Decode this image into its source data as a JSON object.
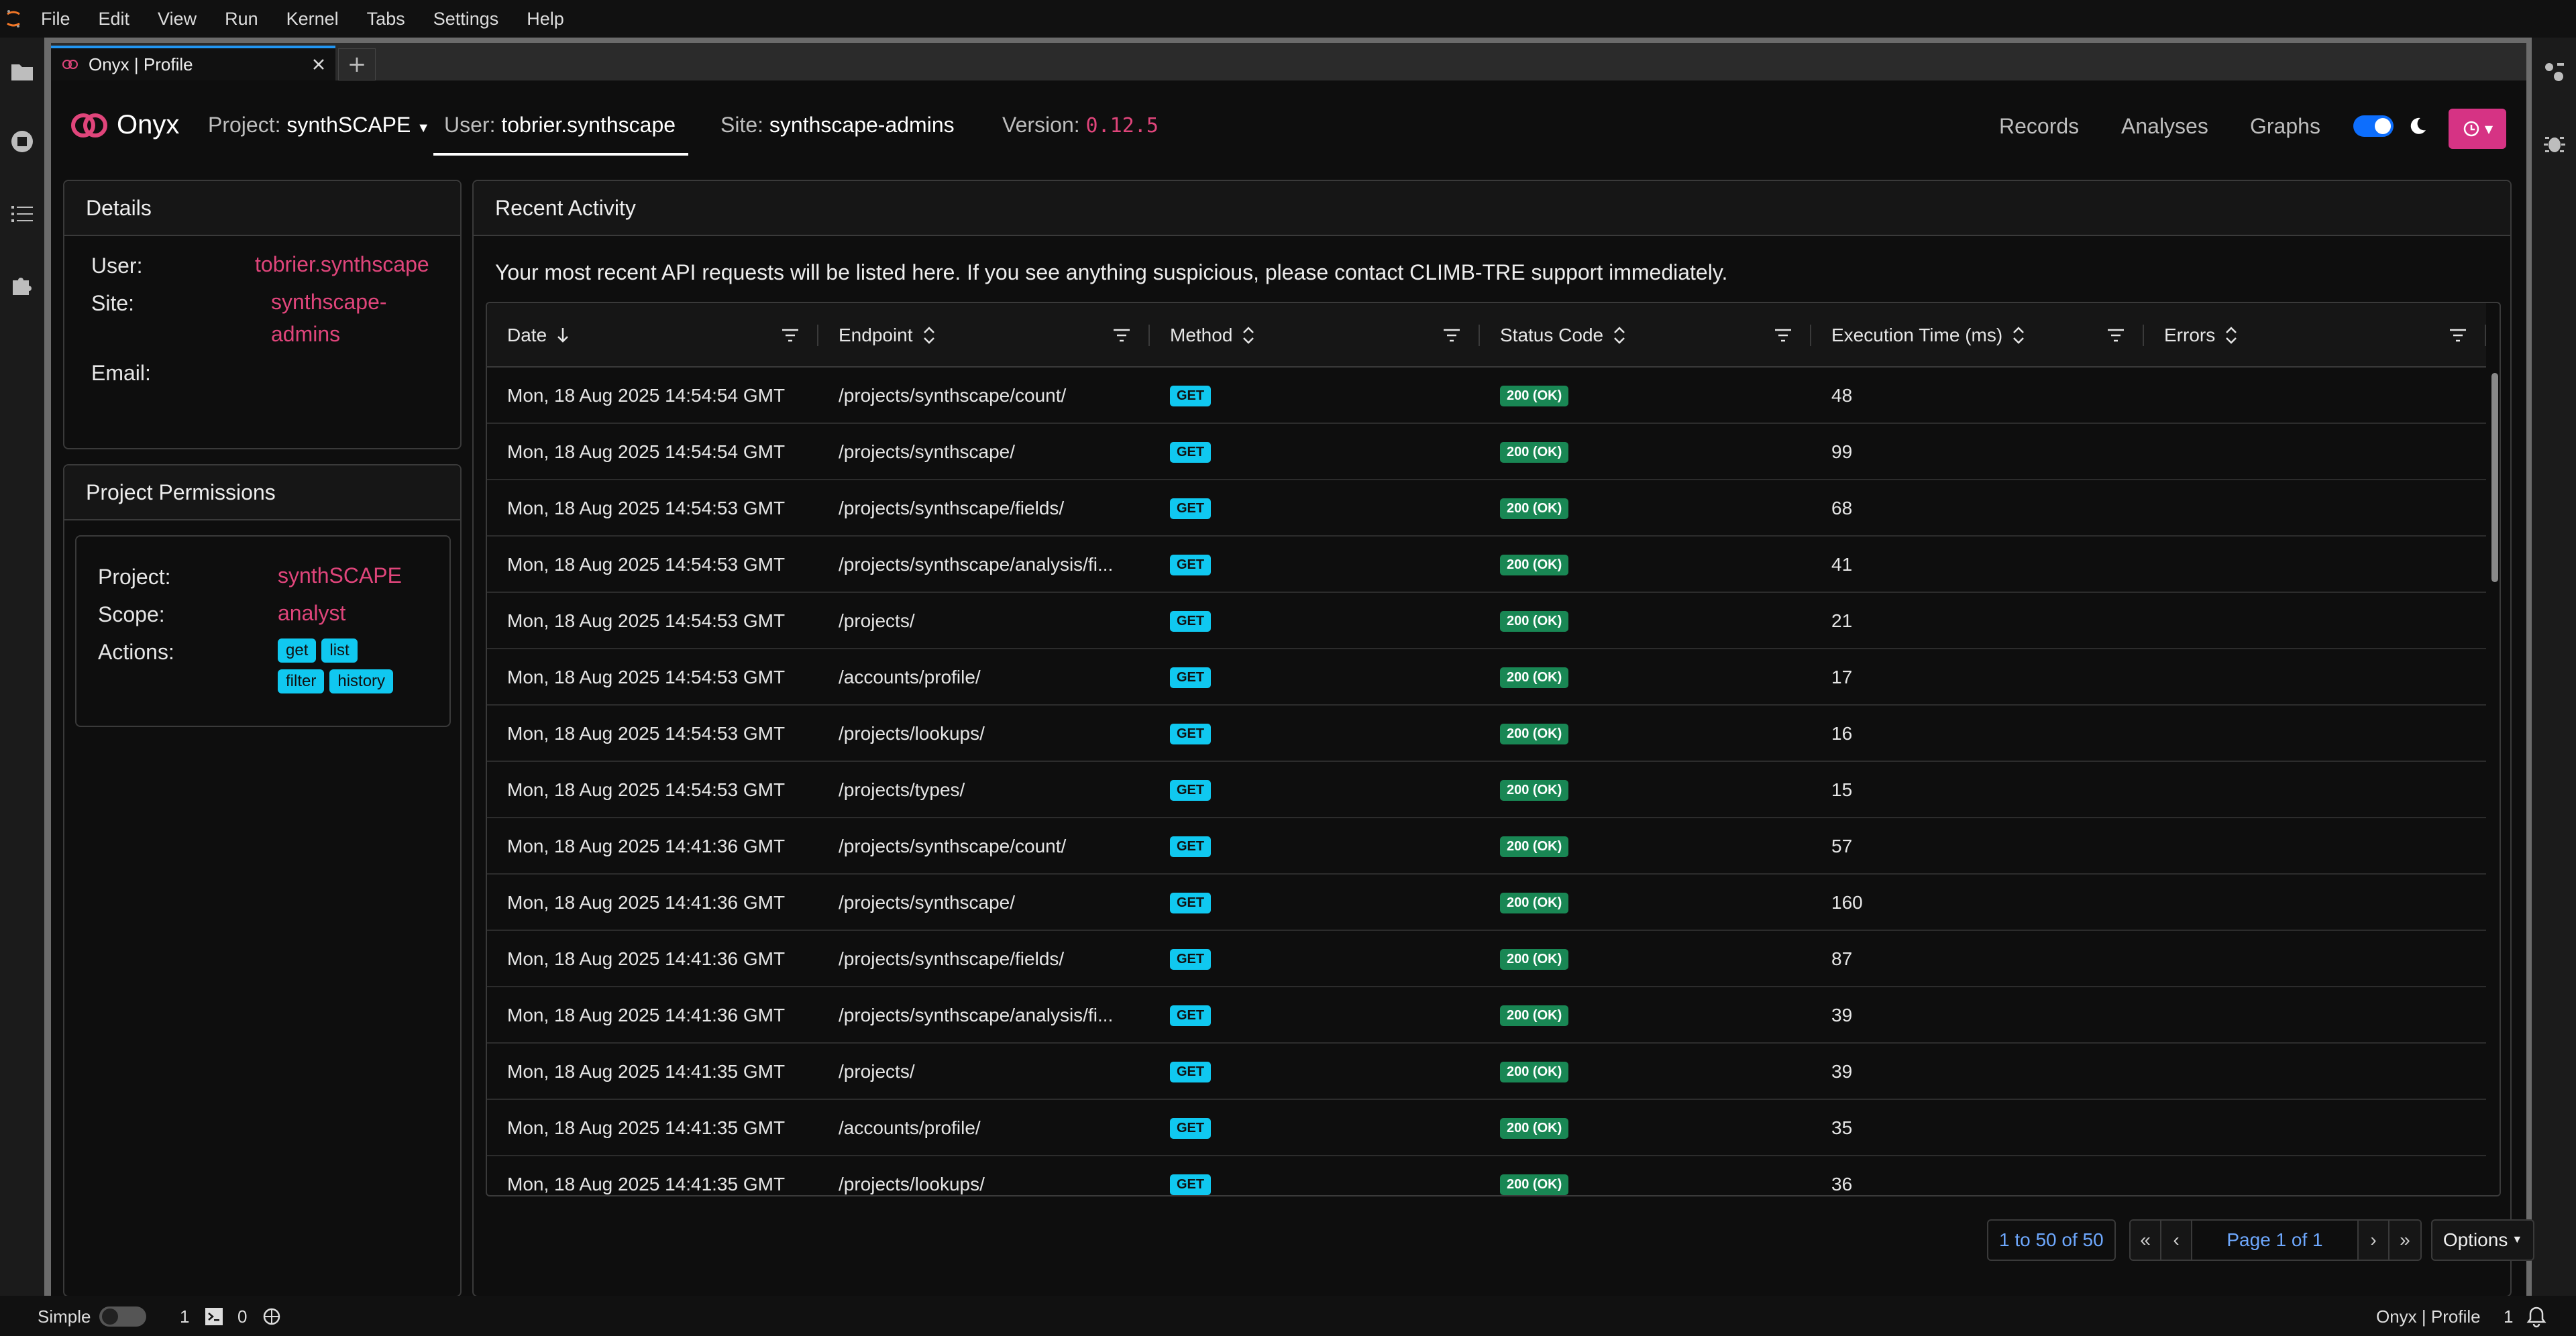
{
  "menubar": {
    "items": [
      "File",
      "Edit",
      "View",
      "Run",
      "Kernel",
      "Tabs",
      "Settings",
      "Help"
    ]
  },
  "tab": {
    "title": "Onyx | Profile",
    "new_tab": "+"
  },
  "navbar": {
    "brand": "Onyx",
    "project_label": "Project:",
    "project_value": "synthSCAPE",
    "user_label": "User:",
    "user_value": "tobrier.synthscape",
    "site_label": "Site:",
    "site_value": "synthscape-admins",
    "version_label": "Version:",
    "version_value": "0.12.5",
    "links": [
      "Records",
      "Analyses",
      "Graphs"
    ],
    "accent_color": "#d63384"
  },
  "details": {
    "title": "Details",
    "user_label": "User:",
    "user_value": "tobrier.synthscape",
    "site_label": "Site:",
    "site_value_line1": "synthscape-",
    "site_value_line2": "admins",
    "email_label": "Email:"
  },
  "permissions": {
    "title": "Project Permissions",
    "project_label": "Project:",
    "project_value": "synthSCAPE",
    "scope_label": "Scope:",
    "scope_value": "analyst",
    "actions_label": "Actions:",
    "actions": [
      "get",
      "list",
      "filter",
      "history"
    ]
  },
  "activity": {
    "title": "Recent Activity",
    "intro": "Your most recent API requests will be listed here. If you see anything suspicious, please contact CLIMB-TRE support immediately.",
    "columns": [
      "Date",
      "Endpoint",
      "Method",
      "Status Code",
      "Execution Time (ms)",
      "Errors"
    ],
    "rows": [
      {
        "date": "Mon, 18 Aug 2025 14:54:54 GMT",
        "endpoint": "/projects/synthscape/count/",
        "method": "GET",
        "status": "200 (OK)",
        "time": "48"
      },
      {
        "date": "Mon, 18 Aug 2025 14:54:54 GMT",
        "endpoint": "/projects/synthscape/",
        "method": "GET",
        "status": "200 (OK)",
        "time": "99"
      },
      {
        "date": "Mon, 18 Aug 2025 14:54:53 GMT",
        "endpoint": "/projects/synthscape/fields/",
        "method": "GET",
        "status": "200 (OK)",
        "time": "68"
      },
      {
        "date": "Mon, 18 Aug 2025 14:54:53 GMT",
        "endpoint": "/projects/synthscape/analysis/fi...",
        "method": "GET",
        "status": "200 (OK)",
        "time": "41"
      },
      {
        "date": "Mon, 18 Aug 2025 14:54:53 GMT",
        "endpoint": "/projects/",
        "method": "GET",
        "status": "200 (OK)",
        "time": "21"
      },
      {
        "date": "Mon, 18 Aug 2025 14:54:53 GMT",
        "endpoint": "/accounts/profile/",
        "method": "GET",
        "status": "200 (OK)",
        "time": "17"
      },
      {
        "date": "Mon, 18 Aug 2025 14:54:53 GMT",
        "endpoint": "/projects/lookups/",
        "method": "GET",
        "status": "200 (OK)",
        "time": "16"
      },
      {
        "date": "Mon, 18 Aug 2025 14:54:53 GMT",
        "endpoint": "/projects/types/",
        "method": "GET",
        "status": "200 (OK)",
        "time": "15"
      },
      {
        "date": "Mon, 18 Aug 2025 14:41:36 GMT",
        "endpoint": "/projects/synthscape/count/",
        "method": "GET",
        "status": "200 (OK)",
        "time": "57"
      },
      {
        "date": "Mon, 18 Aug 2025 14:41:36 GMT",
        "endpoint": "/projects/synthscape/",
        "method": "GET",
        "status": "200 (OK)",
        "time": "160"
      },
      {
        "date": "Mon, 18 Aug 2025 14:41:36 GMT",
        "endpoint": "/projects/synthscape/fields/",
        "method": "GET",
        "status": "200 (OK)",
        "time": "87"
      },
      {
        "date": "Mon, 18 Aug 2025 14:41:36 GMT",
        "endpoint": "/projects/synthscape/analysis/fi...",
        "method": "GET",
        "status": "200 (OK)",
        "time": "39"
      },
      {
        "date": "Mon, 18 Aug 2025 14:41:35 GMT",
        "endpoint": "/projects/",
        "method": "GET",
        "status": "200 (OK)",
        "time": "39"
      },
      {
        "date": "Mon, 18 Aug 2025 14:41:35 GMT",
        "endpoint": "/accounts/profile/",
        "method": "GET",
        "status": "200 (OK)",
        "time": "35"
      },
      {
        "date": "Mon, 18 Aug 2025 14:41:35 GMT",
        "endpoint": "/projects/lookups/",
        "method": "GET",
        "status": "200 (OK)",
        "time": "36"
      }
    ],
    "row_count": "1 to 50 of 50",
    "page_label": "Page 1 of 1",
    "pager_buttons": [
      "«",
      "‹",
      "›",
      "»"
    ],
    "options_label": "Options"
  },
  "statusbar": {
    "mode_label": "Simple",
    "count_a": "1",
    "count_b": "0",
    "doc_title": "Onyx | Profile",
    "right_count": "1"
  }
}
